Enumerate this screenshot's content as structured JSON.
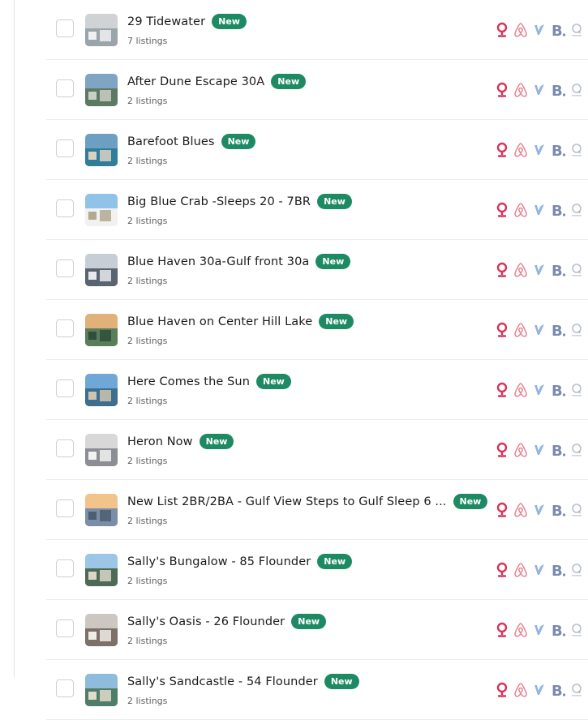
{
  "badge_label": "New",
  "colors": {
    "badge": "#1d8a63",
    "vrbo": "#3d78c9",
    "booking": "#7b8bb0",
    "hvmi": "#8a93a6",
    "pin": "#d6345b",
    "airbnb": "#e8848f"
  },
  "channel_icons": [
    "location-pin-icon",
    "airbnb-icon",
    "vrbo-icon",
    "booking-icon",
    "search-channel-icon"
  ],
  "listings": [
    {
      "title": "29 Tidewater",
      "count": "7 listings"
    },
    {
      "title": "After Dune Escape 30A",
      "count": "2 listings"
    },
    {
      "title": "Barefoot Blues",
      "count": "2 listings"
    },
    {
      "title": "Big Blue Crab -Sleeps 20 - 7BR",
      "count": "2 listings"
    },
    {
      "title": "Blue Haven 30a-Gulf front 30a",
      "count": "2 listings"
    },
    {
      "title": "Blue Haven on Center Hill Lake",
      "count": "2 listings"
    },
    {
      "title": "Here Comes the Sun",
      "count": "2 listings"
    },
    {
      "title": "Heron Now",
      "count": "2 listings"
    },
    {
      "title": "New List 2BR/2BA - Gulf View Steps to Gulf Sleep 6 ...",
      "count": "2 listings"
    },
    {
      "title": "Sally's Bungalow - 85 Flounder",
      "count": "2 listings"
    },
    {
      "title": "Sally's Oasis - 26 Flounder",
      "count": "2 listings"
    },
    {
      "title": "Sally's Sandcastle - 54 Flounder",
      "count": "2 listings"
    }
  ]
}
